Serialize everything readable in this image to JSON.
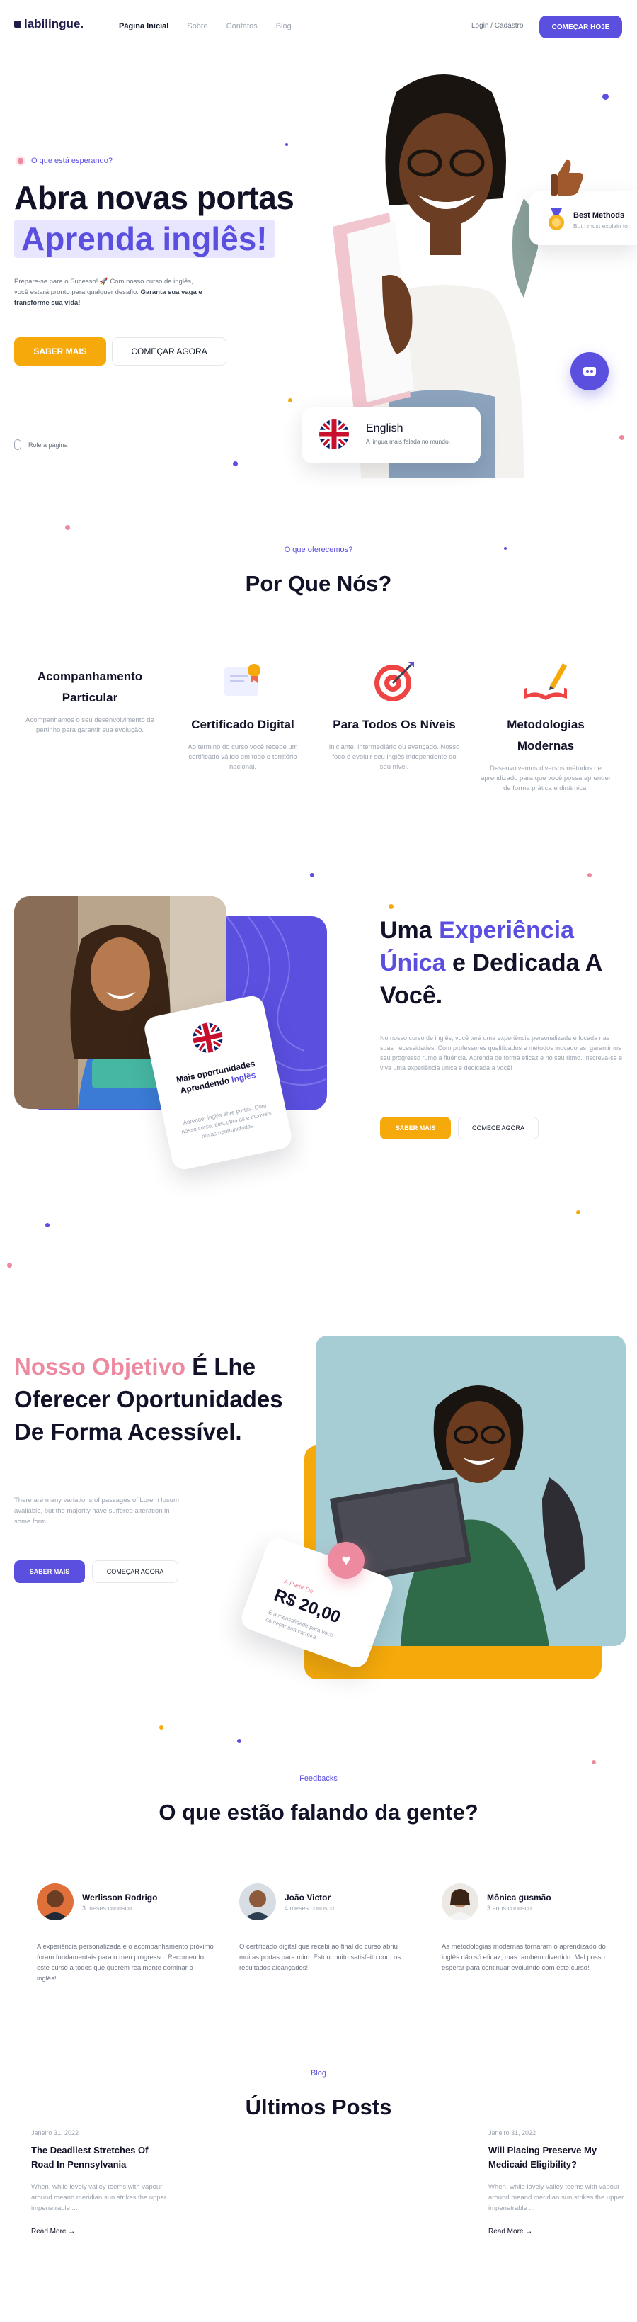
{
  "nav": {
    "logo": "labilingue.",
    "links": [
      "Página Inicial",
      "Sobre",
      "Contatos",
      "Blog"
    ],
    "login": "Login / Cadastro",
    "cta": "COMEÇAR HOJE"
  },
  "hero": {
    "eyebrow": "O que está esperando?",
    "title_line1": "Abra novas portas",
    "title_line2": "Aprenda inglês!",
    "desc_plain": "Prepare-se para o Sucesso! 🚀 Com nosso curso de inglês, você estará pronto para qualquer desafio. ",
    "desc_bold": "Garanta sua vaga e transforme sua vida!",
    "btn_primary": "SABER MAIS",
    "btn_secondary": "COMEÇAR AGORA",
    "scroll_label": "Role a página",
    "best_methods_title": "Best Methods",
    "best_methods_sub": "But I must explain to",
    "english_title": "English",
    "english_sub": "A língua mais falada no mundo."
  },
  "features_section": {
    "eyebrow": "O que oferecemos?",
    "title": "Por Que Nós?",
    "items": [
      {
        "title": "Acompanhamento Particular",
        "desc": "Acompanhamos o seu desenvolvimento de pertinho para garantir sua evolução.",
        "icon": "user-support-icon"
      },
      {
        "title": "Certificado Digital",
        "desc": "Ao término do curso você recebe um certificado válido em todo o território nacional.",
        "icon": "certificate-icon"
      },
      {
        "title": "Para Todos Os Níveis",
        "desc": "Iniciante, intermediário ou avançado. Nosso foco é evoluir seu inglês independente do seu nível.",
        "icon": "target-icon"
      },
      {
        "title": "Metodologias Modernas",
        "desc": "Desenvolvemos diversos métodos de aprendizado para que você possa aprender de forma prática e dinâmica.",
        "icon": "book-pencil-icon"
      }
    ]
  },
  "experience": {
    "title_a": "Uma ",
    "title_b": "Experiência Única",
    "title_c": " e Dedicada A Você.",
    "desc": "No nosso curso de inglês, você terá uma experiência personalizada e focada nas suas necessidades. Com professores qualificados e métodos inovadores, garantimos seu progresso rumo à fluência. Aprenda de forma eficaz e no seu ritmo. Inscreva-se e viva uma experiência única e dedicada a você!",
    "btn_primary": "SABER MAIS",
    "btn_secondary": "COMECE AGORA",
    "card_title_a": "Mais oportunidades Aprendendo ",
    "card_title_b": "Inglês",
    "card_desc": "Aprender inglês abre portas. Com nosso curso, descubra as e incríveis novas oportunidades."
  },
  "objective": {
    "title_a": "Nosso Objetivo",
    "title_b": " É Lhe Oferecer Oportunidades De Forma Acessível.",
    "desc": "There are many variations of passages of Lorem Ipsum available, but the majority have suffered alteration in some form.",
    "btn_primary": "SABER MAIS",
    "btn_secondary": "COMEÇAR AGORA",
    "price_label": "A Partir De",
    "price": "R$ 20,00",
    "price_desc": "É a mensalidade para você começar sua carreira."
  },
  "testimonials": {
    "eyebrow": "Feedbacks",
    "title": "O que estão falando da gente?",
    "items": [
      {
        "name": "Werlisson Rodrigo",
        "since": "3 meses conosco",
        "text": "A experiência personalizada e o acompanhamento próximo foram fundamentais para o meu progresso. Recomendo este curso a todos que querem realmente dominar o inglês!"
      },
      {
        "name": "João Victor",
        "since": "4 meses conosco",
        "text": "O certificado digital que recebi ao final do curso abriu muitas portas para mim. Estou muito satisfeito com os resultados alcançados!"
      },
      {
        "name": "Mônica gusmão",
        "since": "3 anos conosco",
        "text": "As metodologias modernas tornaram o aprendizado do inglês não só eficaz, mas também divertido. Mal posso esperar para continuar evoluindo com este curso!"
      }
    ]
  },
  "blog": {
    "eyebrow": "Blog",
    "title": "Últimos Posts",
    "posts": [
      {
        "date": "Janeiro 31, 2022",
        "title": "The Deadliest Stretches Of Road In Pennsylvania",
        "excerpt": "When, while lovely valley teems with vapour around meand meridian sun strikes the upper impenetrable ...",
        "more": "Read More →"
      },
      {
        "date": "Janeiro 31, 2022",
        "title": "Will Placing Preserve My Medicaid Eligibility?",
        "excerpt": "When, while lovely valley teems with vapour around meand meridian sun strikes the upper impenetrable ...",
        "more": "Read More →"
      }
    ]
  },
  "colors": {
    "brand": "#5b4fe0",
    "accent": "#f5a90a",
    "pink": "#ee8a9f",
    "dark": "#111127"
  }
}
